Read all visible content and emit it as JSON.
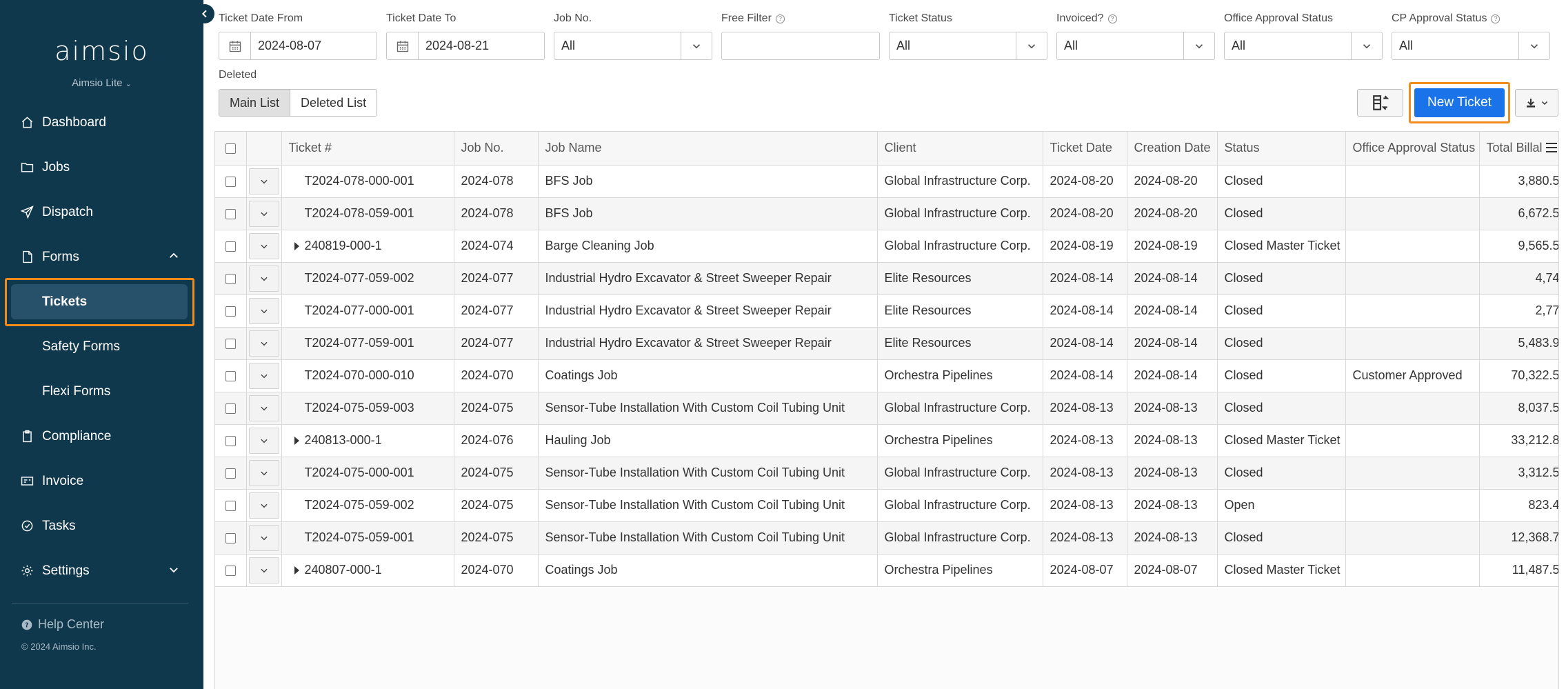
{
  "sidebar": {
    "logo": "aimsio",
    "edition": "Aimsio Lite",
    "nav": {
      "dashboard": "Dashboard",
      "jobs": "Jobs",
      "dispatch": "Dispatch",
      "forms": "Forms",
      "tickets": "Tickets",
      "safety_forms": "Safety Forms",
      "flexi_forms": "Flexi Forms",
      "compliance": "Compliance",
      "invoice": "Invoice",
      "tasks": "Tasks",
      "settings": "Settings"
    },
    "help": "Help Center",
    "copyright": "© 2024 Aimsio Inc."
  },
  "filters": {
    "ticket_date_from": {
      "label": "Ticket Date From",
      "value": "2024-08-07"
    },
    "ticket_date_to": {
      "label": "Ticket Date To",
      "value": "2024-08-21"
    },
    "job_no": {
      "label": "Job No.",
      "value": "All"
    },
    "free_filter": {
      "label": "Free Filter",
      "value": ""
    },
    "ticket_status": {
      "label": "Ticket Status",
      "value": "All"
    },
    "invoiced": {
      "label": "Invoiced?",
      "value": "All"
    },
    "office_approval": {
      "label": "Office Approval Status",
      "value": "All"
    },
    "cp_approval": {
      "label": "CP Approval Status",
      "value": "All"
    }
  },
  "deleted": {
    "label": "Deleted",
    "main_list": "Main List",
    "deleted_list": "Deleted List"
  },
  "toolbar": {
    "new_ticket": "New Ticket"
  },
  "table": {
    "headers": {
      "ticket": "Ticket #",
      "job_no": "Job No.",
      "job_name": "Job Name",
      "client": "Client",
      "ticket_date": "Ticket Date",
      "creation_date": "Creation Date",
      "status": "Status",
      "office_approval": "Office Approval Status",
      "total_billable": "Total Billal"
    },
    "rows": [
      {
        "ticket": "T2024-078-000-001",
        "job_no": "2024-078",
        "job_name": "BFS Job",
        "client": "Global Infrastructure Corp.",
        "ticket_date": "2024-08-20",
        "creation_date": "2024-08-20",
        "status": "Closed",
        "office_approval": "",
        "total": "3,880.5"
      },
      {
        "ticket": "T2024-078-059-001",
        "job_no": "2024-078",
        "job_name": "BFS Job",
        "client": "Global Infrastructure Corp.",
        "ticket_date": "2024-08-20",
        "creation_date": "2024-08-20",
        "status": "Closed",
        "office_approval": "",
        "total": "6,672.5"
      },
      {
        "ticket": "240819-000-1",
        "job_no": "2024-074",
        "job_name": "Barge Cleaning Job",
        "client": "Global Infrastructure Corp.",
        "ticket_date": "2024-08-19",
        "creation_date": "2024-08-19",
        "status": "Closed Master Ticket",
        "office_approval": "",
        "total": "9,565.5"
      },
      {
        "ticket": "T2024-077-059-002",
        "job_no": "2024-077",
        "job_name": "Industrial Hydro Excavator & Street Sweeper Repair",
        "client": "Elite Resources",
        "ticket_date": "2024-08-14",
        "creation_date": "2024-08-14",
        "status": "Closed",
        "office_approval": "",
        "total": "4,74"
      },
      {
        "ticket": "T2024-077-000-001",
        "job_no": "2024-077",
        "job_name": "Industrial Hydro Excavator & Street Sweeper Repair",
        "client": "Elite Resources",
        "ticket_date": "2024-08-14",
        "creation_date": "2024-08-14",
        "status": "Closed",
        "office_approval": "",
        "total": "2,77"
      },
      {
        "ticket": "T2024-077-059-001",
        "job_no": "2024-077",
        "job_name": "Industrial Hydro Excavator & Street Sweeper Repair",
        "client": "Elite Resources",
        "ticket_date": "2024-08-14",
        "creation_date": "2024-08-14",
        "status": "Closed",
        "office_approval": "",
        "total": "5,483.9"
      },
      {
        "ticket": "T2024-070-000-010",
        "job_no": "2024-070",
        "job_name": "Coatings Job",
        "client": "Orchestra Pipelines",
        "ticket_date": "2024-08-14",
        "creation_date": "2024-08-14",
        "status": "Closed",
        "office_approval": "Customer Approved",
        "total": "70,322.5"
      },
      {
        "ticket": "T2024-075-059-003",
        "job_no": "2024-075",
        "job_name": "Sensor-Tube Installation With Custom Coil Tubing Unit",
        "client": "Global Infrastructure Corp.",
        "ticket_date": "2024-08-13",
        "creation_date": "2024-08-13",
        "status": "Closed",
        "office_approval": "",
        "total": "8,037.5"
      },
      {
        "ticket": "240813-000-1",
        "job_no": "2024-076",
        "job_name": "Hauling Job",
        "client": "Orchestra Pipelines",
        "ticket_date": "2024-08-13",
        "creation_date": "2024-08-13",
        "status": "Closed Master Ticket",
        "office_approval": "",
        "total": "33,212.8"
      },
      {
        "ticket": "T2024-075-000-001",
        "job_no": "2024-075",
        "job_name": "Sensor-Tube Installation With Custom Coil Tubing Unit",
        "client": "Global Infrastructure Corp.",
        "ticket_date": "2024-08-13",
        "creation_date": "2024-08-13",
        "status": "Closed",
        "office_approval": "",
        "total": "3,312.5"
      },
      {
        "ticket": "T2024-075-059-002",
        "job_no": "2024-075",
        "job_name": "Sensor-Tube Installation With Custom Coil Tubing Unit",
        "client": "Global Infrastructure Corp.",
        "ticket_date": "2024-08-13",
        "creation_date": "2024-08-13",
        "status": "Open",
        "office_approval": "",
        "total": "823.4"
      },
      {
        "ticket": "T2024-075-059-001",
        "job_no": "2024-075",
        "job_name": "Sensor-Tube Installation With Custom Coil Tubing Unit",
        "client": "Global Infrastructure Corp.",
        "ticket_date": "2024-08-13",
        "creation_date": "2024-08-13",
        "status": "Closed",
        "office_approval": "",
        "total": "12,368.7"
      },
      {
        "ticket": "240807-000-1",
        "job_no": "2024-070",
        "job_name": "Coatings Job",
        "client": "Orchestra Pipelines",
        "ticket_date": "2024-08-07",
        "creation_date": "2024-08-07",
        "status": "Closed Master Ticket",
        "office_approval": "",
        "total": "11,487.5"
      }
    ]
  },
  "colors": {
    "sidebar_bg": "#10384c",
    "accent": "#1a73e8",
    "highlight": "#f28a1e"
  }
}
